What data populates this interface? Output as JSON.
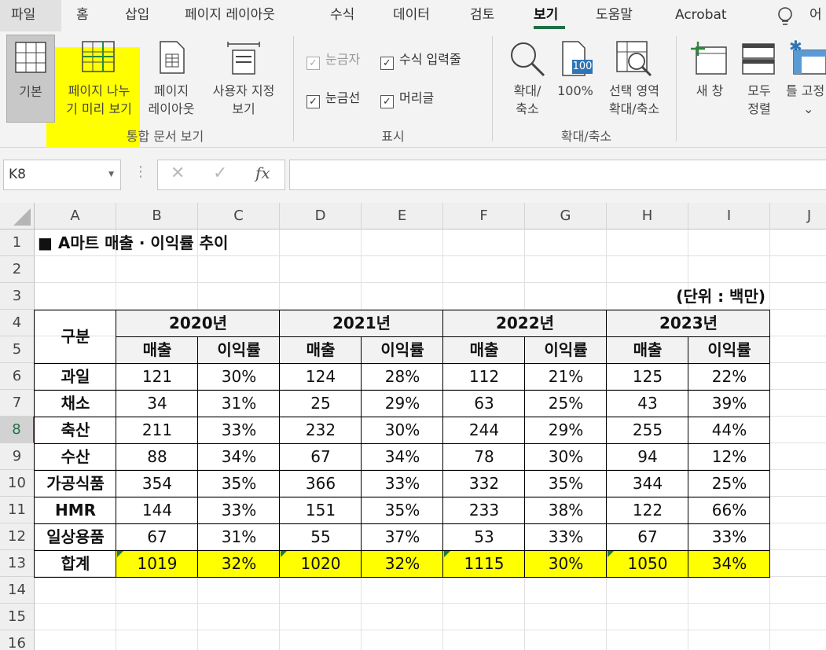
{
  "menu": {
    "tabs": [
      "파일",
      "홈",
      "삽입",
      "페이지 레이아웃",
      "수식",
      "데이터",
      "검토",
      "보기",
      "도움말",
      "Acrobat"
    ],
    "active": "보기",
    "extra": "어"
  },
  "ribbon": {
    "views": {
      "normal": "기본",
      "page_break_1": "페이지 나누",
      "page_break_2": "기 미리 보기",
      "page_layout_1": "페이지",
      "page_layout_2": "레이아웃",
      "custom_1": "사용자 지정",
      "custom_2": "보기",
      "group": "통합 문서 보기"
    },
    "show": {
      "ruler": "눈금자",
      "formula_bar": "수식 입력줄",
      "gridlines": "눈금선",
      "headings": "머리글",
      "group": "표시"
    },
    "zoom": {
      "zoom_1": "확대/",
      "zoom_2": "축소",
      "hundred": "100%",
      "hundred_icon": "100",
      "selection_1": "선택 영역",
      "selection_2": "확대/축소",
      "group": "확대/축소"
    },
    "window": {
      "new_window": "새 창",
      "arrange_1": "모두",
      "arrange_2": "정렬",
      "freeze": "틀 고정",
      "freeze_arrow": "⌄"
    }
  },
  "formula_bar": {
    "name_box": "K8",
    "fx": "fx",
    "cancel": "✕",
    "enter": "✓",
    "dots": "⋮",
    "value": ""
  },
  "columns": [
    "A",
    "B",
    "C",
    "D",
    "E",
    "F",
    "G",
    "H",
    "I",
    "J"
  ],
  "rows": [
    "1",
    "2",
    "3",
    "4",
    "5",
    "6",
    "7",
    "8",
    "9",
    "10",
    "11",
    "12",
    "13",
    "14",
    "15",
    "16"
  ],
  "sheet": {
    "title": "■ A마트 매출 · 이익률 추이",
    "unit": "(단위 : 백만)",
    "category_header": "구분",
    "years": [
      "2020년",
      "2021년",
      "2022년",
      "2023년"
    ],
    "sales_label": "매출",
    "margin_label": "이익률",
    "items": [
      {
        "name": "과일",
        "vals": [
          "121",
          "30%",
          "124",
          "28%",
          "112",
          "21%",
          "125",
          "22%"
        ]
      },
      {
        "name": "채소",
        "vals": [
          "34",
          "31%",
          "25",
          "29%",
          "63",
          "25%",
          "43",
          "39%"
        ]
      },
      {
        "name": "축산",
        "vals": [
          "211",
          "33%",
          "232",
          "30%",
          "244",
          "29%",
          "255",
          "44%"
        ]
      },
      {
        "name": "수산",
        "vals": [
          "88",
          "34%",
          "67",
          "34%",
          "78",
          "30%",
          "94",
          "12%"
        ]
      },
      {
        "name": "가공식품",
        "vals": [
          "354",
          "35%",
          "366",
          "33%",
          "332",
          "35%",
          "344",
          "25%"
        ]
      },
      {
        "name": "HMR",
        "vals": [
          "144",
          "33%",
          "151",
          "35%",
          "233",
          "38%",
          "122",
          "66%"
        ]
      },
      {
        "name": "일상용품",
        "vals": [
          "67",
          "31%",
          "55",
          "37%",
          "53",
          "33%",
          "67",
          "33%"
        ]
      }
    ],
    "total": {
      "name": "합계",
      "vals": [
        "1019",
        "32%",
        "1020",
        "32%",
        "1115",
        "30%",
        "1050",
        "34%"
      ]
    },
    "highlight_color": "#ffff00",
    "selected_row": "8"
  }
}
